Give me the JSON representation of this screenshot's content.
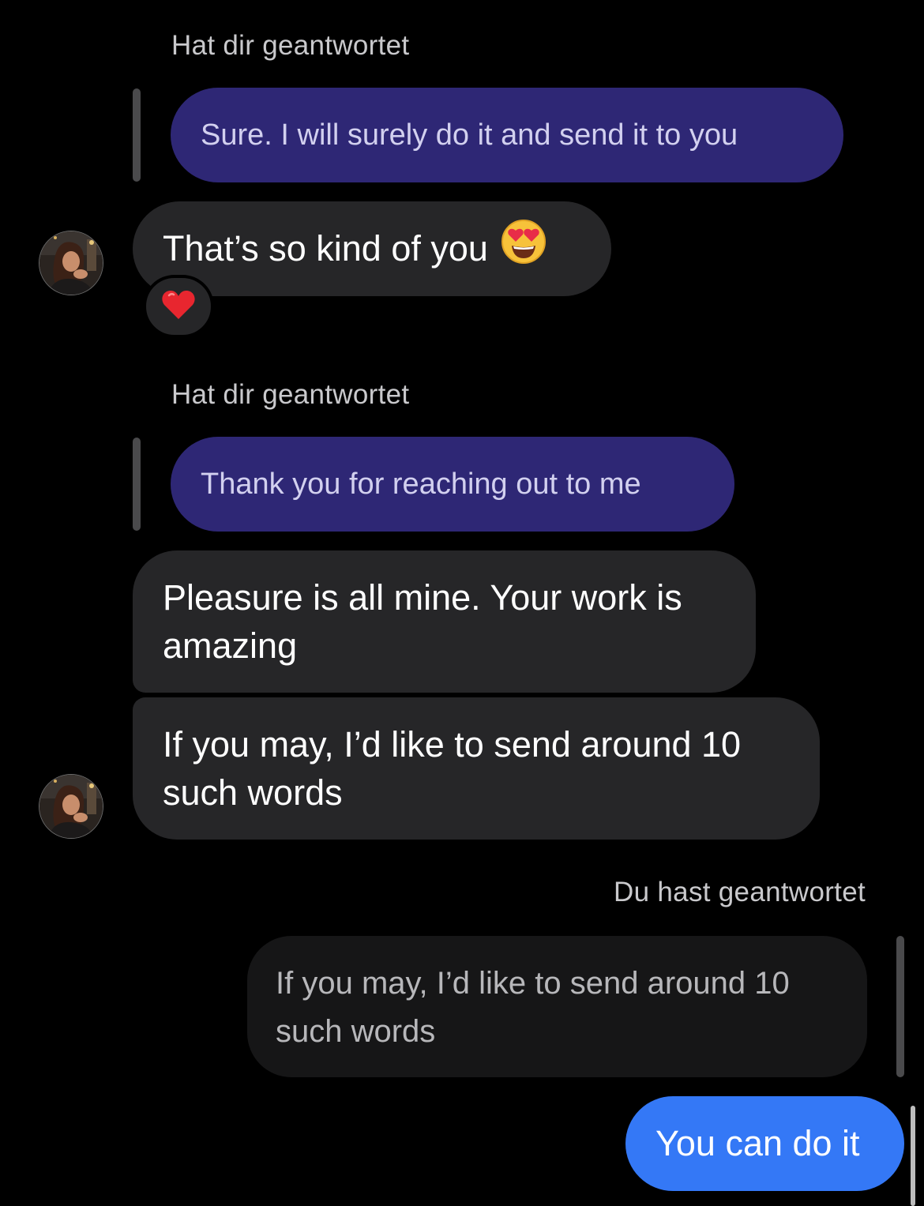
{
  "messages": [
    {
      "reply_label": "Hat dir geantwortet",
      "quoted_text": "Sure. I will surely do it and send it to you"
    },
    {
      "text": "That’s so kind of you",
      "emoji": "heart-eyes-emoji",
      "reaction": "red-heart-emoji"
    },
    {
      "reply_label": "Hat dir geantwortet",
      "quoted_text": "Thank you for reaching out to me"
    },
    {
      "text": "Pleasure is all mine. Your work is amazing"
    },
    {
      "text": "If you may, I’d like to send around 10 such words"
    },
    {
      "reply_label": "Du hast geantwortet",
      "quoted_text": "If you may, I’d like to send around 10 such words"
    },
    {
      "text": "You can do it"
    }
  ],
  "colors": {
    "background": "#000000",
    "quoted_incoming_bubble": "#2e2775",
    "incoming_bubble": "#262628",
    "quoted_outgoing_bubble": "#161617",
    "outgoing_bubble": "#3478f6",
    "reply_bar": "#4a4a4c"
  }
}
